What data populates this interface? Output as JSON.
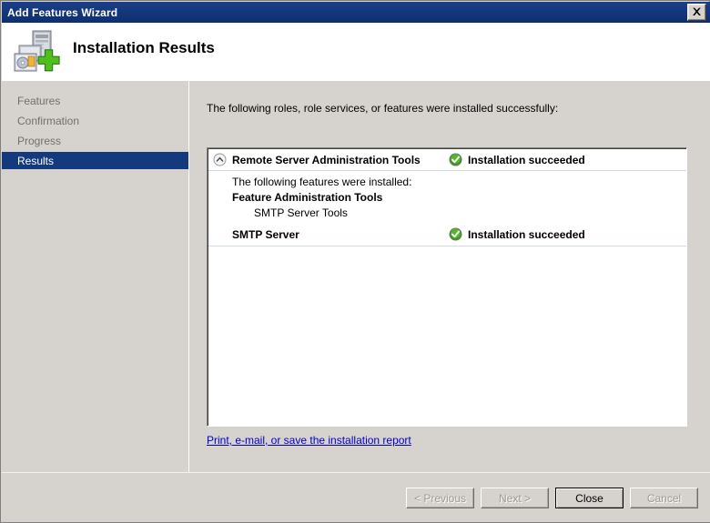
{
  "window": {
    "title": "Add Features Wizard",
    "close_icon": "close-icon"
  },
  "header": {
    "title": "Installation Results",
    "icon": "add-features-server-icon"
  },
  "sidebar": {
    "items": [
      {
        "label": "Features",
        "active": false
      },
      {
        "label": "Confirmation",
        "active": false
      },
      {
        "label": "Progress",
        "active": false
      },
      {
        "label": "Results",
        "active": true
      }
    ]
  },
  "main": {
    "intro": "The following roles, role services, or features were installed successfully:",
    "results": [
      {
        "name": "Remote Server Administration Tools",
        "status": "Installation succeeded",
        "status_icon": "success-check-icon",
        "collapse_icon": "chevron-up-circle-icon",
        "details": [
          {
            "text": "The following features were installed:",
            "level": 0
          },
          {
            "text": "Feature Administration Tools",
            "level": 1
          },
          {
            "text": "SMTP Server Tools",
            "level": 2
          }
        ]
      },
      {
        "name": "SMTP Server",
        "status": "Installation succeeded",
        "status_icon": "success-check-icon"
      }
    ],
    "report_link": "Print, e-mail, or save the installation report"
  },
  "footer": {
    "buttons": [
      {
        "label": "< Previous",
        "enabled": false,
        "default": false
      },
      {
        "label": "Next >",
        "enabled": false,
        "default": false
      },
      {
        "label": "Close",
        "enabled": true,
        "default": true
      },
      {
        "label": "Cancel",
        "enabled": false,
        "default": false
      }
    ]
  },
  "colors": {
    "titlebar": "#123a7c",
    "accent_highlight": "#123a7c",
    "window_bg": "#d6d3ce",
    "panel_bg": "#ffffff",
    "link": "#0000cc",
    "success": "#3aa017",
    "disabled_text": "#9d9a95"
  }
}
